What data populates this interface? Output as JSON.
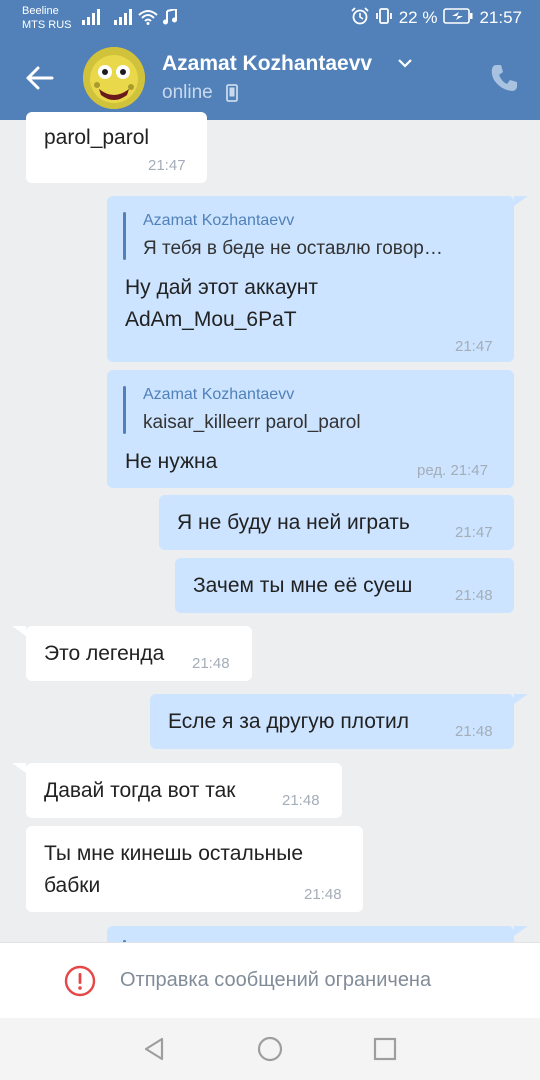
{
  "status_bar": {
    "carrier1": "Beeline",
    "carrier2": "MTS RUS",
    "battery": "22 %",
    "time": "21:57"
  },
  "header": {
    "contact_name": "Azamat Kozhantaevv",
    "status": "online"
  },
  "messages": [
    {
      "id": "m1",
      "text": "parol_parol",
      "time": "21:47"
    },
    {
      "id": "m2",
      "reply_name": "Azamat Kozhantaevv",
      "reply_text": "Я тебя в беде не оставлю говор…",
      "line1": "Ну дай этот аккаунт",
      "line2": "AdAm_Mou_6PaT",
      "time": "21:47"
    },
    {
      "id": "m3",
      "reply_name": "Azamat Kozhantaevv",
      "reply_text": "kaisar_killeerr parol_parol",
      "text": "Не нужна",
      "time": "ред. 21:47"
    },
    {
      "id": "m4",
      "text": "Я не буду на ней играть",
      "time": "21:47"
    },
    {
      "id": "m5",
      "text": "Зачем ты мне её суеш",
      "time": "21:48"
    },
    {
      "id": "m6",
      "text": "Это легенда",
      "time": "21:48"
    },
    {
      "id": "m7",
      "text": "Есле я за другую плотил",
      "time": "21:48"
    },
    {
      "id": "m8",
      "text": "Давай тогда вот так",
      "time": "21:48"
    },
    {
      "id": "m9",
      "line1": "Ты мне кинешь остальные",
      "line2": "бабки",
      "time": "21:48"
    }
  ],
  "footer": {
    "restricted_text": "Отправка сообщений ограничена"
  },
  "colors": {
    "header_bg": "#5181b8",
    "chat_bg": "#edeef0",
    "outgoing_bubble": "#cce4ff",
    "incoming_bubble": "#ffffff",
    "warning_red": "#e64646"
  }
}
